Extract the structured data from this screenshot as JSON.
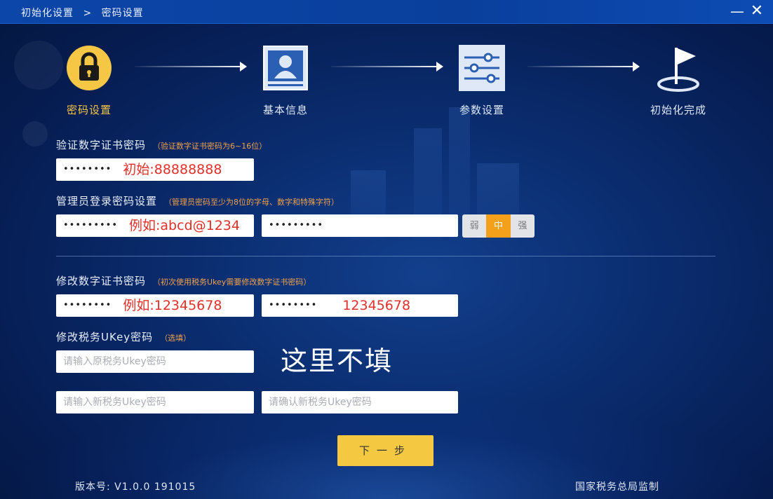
{
  "titlebar": {
    "crumb_root": "初始化设置",
    "crumb_sep": ">",
    "crumb_current": "密码设置",
    "minimize": "—",
    "close": "✕"
  },
  "steps": [
    {
      "label": "密码设置",
      "icon": "lock-icon",
      "active": true
    },
    {
      "label": "基本信息",
      "icon": "user-card-icon",
      "active": false
    },
    {
      "label": "参数设置",
      "icon": "sliders-icon",
      "active": false
    },
    {
      "label": "初始化完成",
      "icon": "flag-icon",
      "active": false
    }
  ],
  "verify_cert": {
    "title": "验证数字证书密码",
    "hint": "（验证数字证书密码为6~16位）",
    "field": {
      "dots": "••••••••",
      "annotation": "初始:88888888"
    }
  },
  "admin_login": {
    "title": "管理员登录密码设置",
    "hint": "（管理员密码至少为8位的字母、数字和特殊字符）",
    "field1": {
      "dots": "•••••••••",
      "annotation": "例如:abcd@1234"
    },
    "field2": {
      "dots": "•••••••••"
    },
    "strength": {
      "weak": "弱",
      "medium": "中",
      "strong": "强",
      "selected": "中"
    }
  },
  "change_cert": {
    "title": "修改数字证书密码",
    "hint": "（初次使用税务Ukey需要修改数字证书密码）",
    "field1": {
      "dots": "••••••••",
      "annotation": "例如:12345678"
    },
    "field2": {
      "dots": "••••••••",
      "annotation": "12345678"
    }
  },
  "change_ukey": {
    "title": "修改税务UKey密码",
    "hint": "（选填）",
    "old_placeholder": "请输入原税务Ukey密码",
    "new_placeholder": "请输入新税务Ukey密码",
    "confirm_placeholder": "请确认新税务Ukey密码"
  },
  "overlay_note": "这里不填",
  "next_button": "下一步",
  "footer": {
    "version": "版本号: V1.0.0 191015",
    "supervisor": "国家税务总局监制"
  },
  "colors": {
    "accent_yellow": "#f5c842",
    "strength_orange": "#f5a01a",
    "annotation_red": "#e0302a",
    "hint_orange": "#f0a24a",
    "titlebar_blue": "#0b46a8"
  }
}
